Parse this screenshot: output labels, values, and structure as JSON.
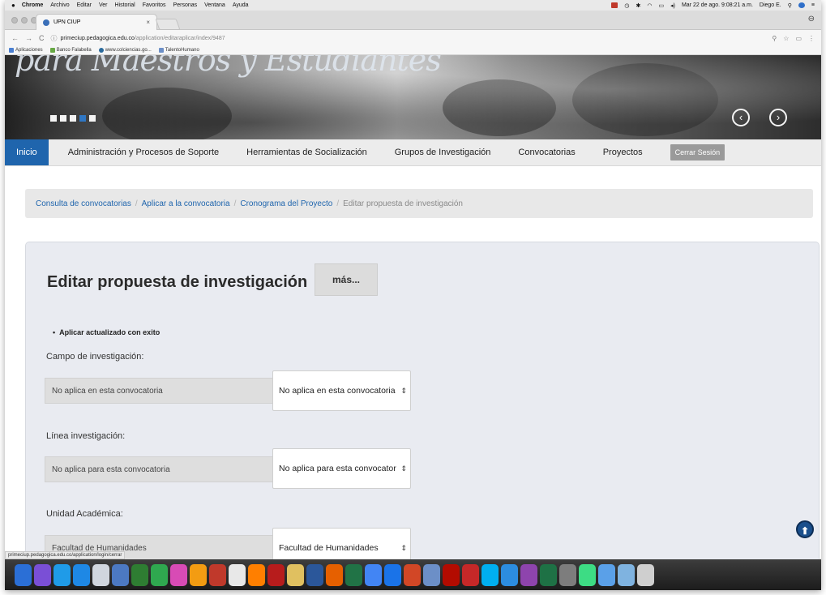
{
  "menubar": {
    "apple": "",
    "items": [
      "Chrome",
      "Archivo",
      "Editar",
      "Ver",
      "Historial",
      "Favoritos",
      "Personas",
      "Ventana",
      "Ayuda"
    ],
    "datetime": "Mar 22 de ago. 9:08:21 a.m.",
    "user": "Diego E."
  },
  "browser": {
    "tab_title": "UPN CIUP",
    "tab_close": "×",
    "url_host": "primeciup.pedagogica.edu.co",
    "url_path": "/application/editaraplicar/index/9487",
    "bookmarks": [
      {
        "label": "Aplicaciones",
        "color": "#4a7fd1"
      },
      {
        "label": "Banco Falabella",
        "color": "#67a844"
      },
      {
        "label": "www.colciencias.go...",
        "color": "#2a6a9c"
      },
      {
        "label": "TalentoHumano",
        "color": "#6c8fc7"
      }
    ],
    "status_url": "primeciup.pedagogica.edu.co/application/login/cerrar"
  },
  "hero": {
    "tagline": "para Maestros y Estudiantes",
    "prev_arrow": "‹",
    "next_arrow": "›"
  },
  "nav": {
    "home": "Inicio",
    "items": [
      "Administración y Procesos de Soporte",
      "Herramientas de Socialización",
      "Grupos de Investigación",
      "Convocatorias",
      "Proyectos"
    ],
    "logout": "Cerrar Sesión"
  },
  "breadcrumb": {
    "items": [
      "Consulta de convocatorias",
      "Aplicar a la convocatoria",
      "Cronograma del Proyecto"
    ],
    "separator": "/",
    "current": "Editar propuesta de investigación"
  },
  "form": {
    "title": "Editar propuesta de investigación",
    "more_button": "más...",
    "message": "Aplicar actualizado con exito",
    "fields": [
      {
        "label": "Campo de investigación:",
        "readonly_value": "No aplica en esta convocatoria",
        "select_value": "No aplica en esta convocatoria"
      },
      {
        "label": "Línea investigación:",
        "readonly_value": "No aplica para esta convocatoria",
        "select_value": "No aplica para esta convocator"
      },
      {
        "label": "Unidad Académica:",
        "readonly_value": "Facultad de Humanidades",
        "select_value": "Facultad de Humanidades"
      }
    ]
  },
  "colors": {
    "brand_blue": "#1f65ad",
    "panel_bg": "#e9ebf1",
    "logout_bg": "#9a9a9a"
  },
  "dock_apps": [
    "finder",
    "siri",
    "safari",
    "app-store",
    "preview",
    "photos",
    "calendar",
    "notes",
    "itunes",
    "ibooks",
    "vox",
    "calendar-22",
    "vlc",
    "photo-booth",
    "pencil",
    "word",
    "firefox",
    "excel",
    "chrome",
    "onedrive",
    "powerpoint",
    "preview-2",
    "acrobat",
    "sketchup",
    "skype",
    "ios-simulator",
    "games",
    "excel-2",
    "system-preferences",
    "android-studio",
    "downloads",
    "documents",
    "trash"
  ]
}
